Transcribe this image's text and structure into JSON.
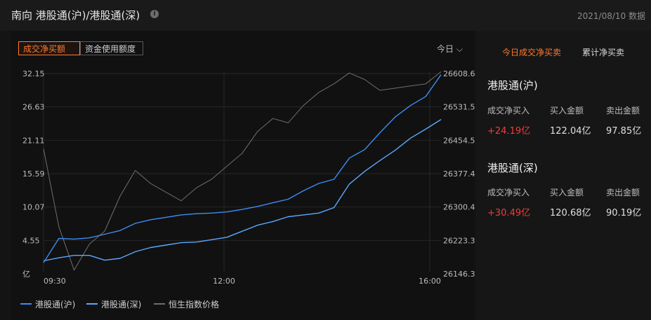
{
  "header": {
    "title": "南向 港股通(沪)/港股通(深)",
    "info_icon": "i",
    "date": "2021/08/10 数据"
  },
  "chart_tabs": [
    "成交净买额",
    "资金使用额度"
  ],
  "period": "今日 ⌵",
  "right_tabs": [
    "今日成交净买卖",
    "累计净买卖"
  ],
  "stats": [
    {
      "name": "港股通(沪)",
      "labels": [
        "成交净买入",
        "买入金额",
        "卖出金额"
      ],
      "values": [
        "+24.19亿",
        "122.04亿",
        "97.85亿"
      ]
    },
    {
      "name": "港股通(深)",
      "labels": [
        "成交净买入",
        "买入金额",
        "卖出金额"
      ],
      "values": [
        "+30.49亿",
        "120.68亿",
        "90.19亿"
      ]
    }
  ],
  "colors": {
    "accent": "#ff7a2e",
    "positive": "#f23b3b",
    "sh_line": "#3d8df5",
    "sz_line": "#5aa9ff",
    "hsi_line": "#6f6f6f"
  },
  "chart_data": {
    "type": "line",
    "x_ticks": [
      "09:30",
      "12:00",
      "16:00"
    ],
    "y_left_ticks": [
      "32.15",
      "26.63",
      "21.11",
      "15.59",
      "10.07",
      "4.55",
      "亿"
    ],
    "y_right_ticks": [
      "26608.6",
      "26531.5",
      "26454.5",
      "26377.4",
      "26300.4",
      "26223.3",
      "26146.3"
    ],
    "y_left_range": [
      -1,
      32.15
    ],
    "y_right_range": [
      26146.3,
      26608.6
    ],
    "x": [
      "09:30",
      "09:45",
      "10:00",
      "10:15",
      "10:30",
      "10:45",
      "11:00",
      "11:15",
      "11:30",
      "11:45",
      "12:00",
      "12:15",
      "12:30",
      "12:45",
      "13:00",
      "13:15",
      "13:30",
      "13:45",
      "14:00",
      "14:15",
      "14:30",
      "14:45",
      "15:00",
      "15:15",
      "15:30",
      "15:45",
      "16:00"
    ],
    "series": [
      {
        "name": "港股通(沪)",
        "axis": "left",
        "values": [
          0.5,
          4.5,
          4.4,
          4.6,
          5.2,
          5.8,
          7.0,
          7.6,
          8.0,
          8.4,
          8.6,
          8.7,
          8.9,
          9.3,
          9.8,
          10.4,
          11.0,
          12.4,
          13.6,
          14.3,
          17.8,
          19.2,
          22.0,
          24.6,
          26.5,
          28.0,
          31.6
        ]
      },
      {
        "name": "港股通(深)",
        "axis": "left",
        "values": [
          0.8,
          1.3,
          1.7,
          1.7,
          0.9,
          1.2,
          2.3,
          3.0,
          3.4,
          3.8,
          3.9,
          4.3,
          4.7,
          5.7,
          6.7,
          7.3,
          8.1,
          8.4,
          8.7,
          9.6,
          13.5,
          15.6,
          17.4,
          19.1,
          21.1,
          22.6,
          24.2
        ]
      },
      {
        "name": "恒生指数价格",
        "axis": "right",
        "values": [
          26430,
          26250,
          26150,
          26210,
          26240,
          26320,
          26380,
          26350,
          26330,
          26310,
          26340,
          26360,
          26390,
          26420,
          26470,
          26500,
          26490,
          26530,
          26560,
          26580,
          26605,
          26590,
          26565,
          26570,
          26575,
          26580,
          26608
        ]
      }
    ]
  },
  "legend": [
    "港股通(沪)",
    "港股通(深)",
    "恒生指数价格"
  ]
}
